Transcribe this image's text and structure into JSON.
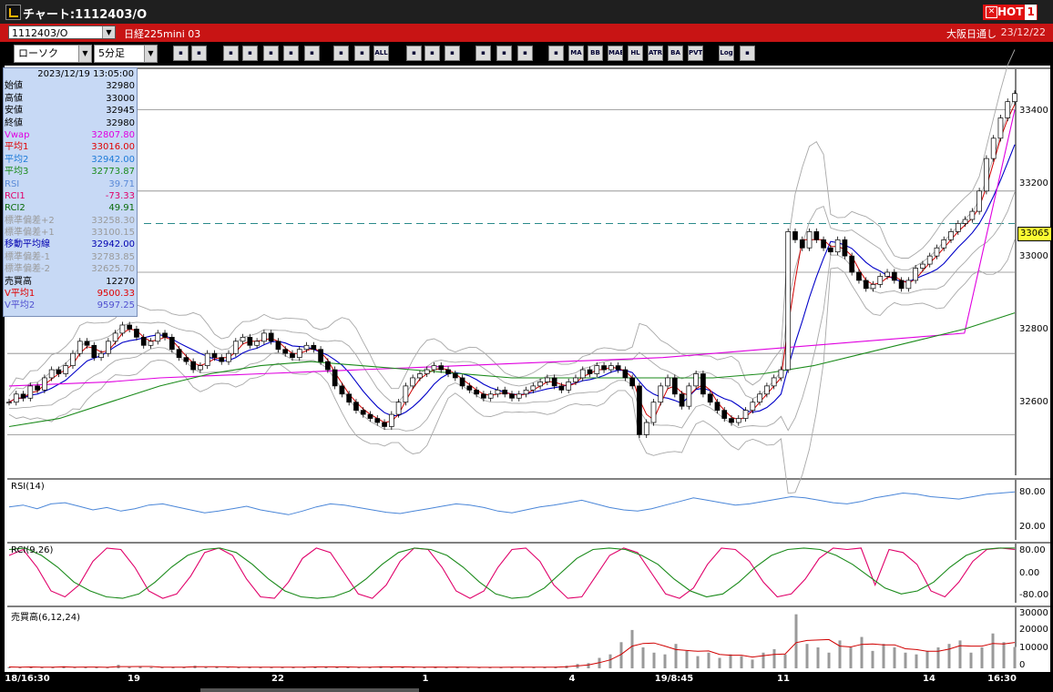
{
  "window": {
    "title": "チャート:1112403/O",
    "hot_label": "HOT",
    "hot_num": "1"
  },
  "infobar": {
    "symbol": "1112403/O",
    "name": "日経225mini 03",
    "market": "大阪日通し",
    "date": "23/12/22"
  },
  "toolbar": {
    "chart_type": "ローソク",
    "interval": "5分足",
    "buttons": [
      "zoom",
      "crosshair",
      "chart1",
      "chart2",
      "chart3",
      "chart4",
      "chart5",
      "candle-up",
      "candle-down",
      "all",
      "draw",
      "select",
      "arrow",
      "gear",
      "settings",
      "palette",
      "ind1",
      "ma",
      "bb",
      "wrae",
      "hl",
      "atr",
      "ba",
      "pvt",
      "log",
      "fit"
    ],
    "button_labels": {
      "all": "ALL",
      "ma": "MA",
      "bb": "BB",
      "wrae": "MAE",
      "hl": "HL",
      "atr": "ATR",
      "ba": "BA",
      "pvt": "PVT",
      "log": "Log"
    }
  },
  "info_panel": {
    "datetime": "2023/12/19  13:05:00",
    "rows": [
      {
        "k": "始値",
        "v": "32980",
        "c": "#000000"
      },
      {
        "k": "高値",
        "v": "33000",
        "c": "#000000"
      },
      {
        "k": "安値",
        "v": "32945",
        "c": "#000000"
      },
      {
        "k": "終値",
        "v": "32980",
        "c": "#000000"
      },
      {
        "k": "Vwap",
        "v": "32807.80",
        "c": "#e000e0"
      },
      {
        "k": "平均1",
        "v": "33016.00",
        "c": "#e00000"
      },
      {
        "k": "平均2",
        "v": "32942.00",
        "c": "#1e7bd8"
      },
      {
        "k": "平均3",
        "v": "32773.87",
        "c": "#1a8a1a"
      },
      {
        "k": "RSI",
        "v": "39.71",
        "c": "#5a8ad8"
      },
      {
        "k": "RCI1",
        "v": "-73.33",
        "c": "#e0006a"
      },
      {
        "k": "RCI2",
        "v": "49.91",
        "c": "#0a6a0a"
      },
      {
        "k": "標準偏差+2",
        "v": "33258.30",
        "c": "#9a9a9a"
      },
      {
        "k": "標準偏差+1",
        "v": "33100.15",
        "c": "#9a9a9a"
      },
      {
        "k": "移動平均線",
        "v": "32942.00",
        "c": "#0000b0"
      },
      {
        "k": "標準偏差-1",
        "v": "32783.85",
        "c": "#9a9a9a"
      },
      {
        "k": "標準偏差-2",
        "v": "32625.70",
        "c": "#9a9a9a"
      },
      {
        "k": "売買高",
        "v": "12270",
        "c": "#000000"
      },
      {
        "k": "V平均1",
        "v": "9500.33",
        "c": "#e00000"
      },
      {
        "k": "V平均2",
        "v": "9597.25",
        "c": "#5050d0"
      }
    ]
  },
  "panes": {
    "price": {
      "y_labels": [
        "33400",
        "33200",
        "33000",
        "32800",
        "32600"
      ],
      "current": "33065"
    },
    "rsi": {
      "label": "RSI(14)",
      "y_labels": [
        "80.00",
        "20.00"
      ]
    },
    "rci": {
      "label": "RCI(9,26)",
      "y_labels": [
        "80.00",
        "0.00",
        "-80.00"
      ]
    },
    "volume": {
      "label": "売買高(6,12,24)",
      "y_labels": [
        "30000",
        "20000",
        "10000",
        "0"
      ]
    }
  },
  "x_labels": [
    "18/16:30",
    "19",
    "22",
    "1",
    "4",
    "19/8:45",
    "11",
    "14",
    "16:30"
  ],
  "chart_data": [
    {
      "type": "candlestick",
      "title": "",
      "ylim": [
        32500,
        33500
      ],
      "y_ticks": [
        33400,
        33200,
        33000,
        32800,
        32600
      ],
      "current_price": 33065,
      "x_tick_labels": [
        "18/16:30",
        "19",
        "22",
        "1",
        "4",
        "19/8:45",
        "11",
        "14",
        "16:30"
      ],
      "close_series": [
        32680,
        32700,
        32690,
        32720,
        32710,
        32740,
        32760,
        32750,
        32770,
        32800,
        32830,
        32820,
        32790,
        32800,
        32830,
        32850,
        32870,
        32860,
        32840,
        32820,
        32830,
        32850,
        32840,
        32810,
        32790,
        32780,
        32760,
        32770,
        32800,
        32790,
        32780,
        32800,
        32830,
        32840,
        32820,
        32830,
        32850,
        32830,
        32810,
        32800,
        32790,
        32810,
        32820,
        32810,
        32780,
        32760,
        32720,
        32700,
        32680,
        32660,
        32650,
        32640,
        32630,
        32620,
        32650,
        32680,
        32720,
        32740,
        32750,
        32760,
        32770,
        32760,
        32750,
        32740,
        32720,
        32710,
        32700,
        32690,
        32700,
        32710,
        32700,
        32690,
        32700,
        32710,
        32720,
        32730,
        32740,
        32720,
        32710,
        32730,
        32740,
        32760,
        32750,
        32770,
        32760,
        32770,
        32760,
        32740,
        32720,
        32600,
        32630,
        32680,
        32720,
        32740,
        32700,
        32670,
        32720,
        32750,
        32700,
        32680,
        32660,
        32640,
        32630,
        32640,
        32660,
        32680,
        32700,
        32720,
        32740,
        32760,
        33100,
        33080,
        33060,
        33100,
        33080,
        33060,
        33050,
        33080,
        33040,
        33000,
        32980,
        32960,
        32970,
        32990,
        33000,
        32980,
        32960,
        32980,
        33010,
        33020,
        33040,
        33060,
        33080,
        33100,
        33120,
        33130,
        33150,
        33200,
        33280,
        33330,
        33380,
        33420,
        33440
      ],
      "series": [
        {
          "name": "Vwap",
          "color": "#e000e0",
          "values": [
            32720,
            32725,
            32730,
            32740,
            32745,
            32750,
            32755,
            32760,
            32765,
            32770,
            32775,
            32780,
            32785,
            32790,
            32800,
            32810,
            32820,
            32830,
            32840,
            32850,
            33400
          ]
        },
        {
          "name": "平均3",
          "color": "#1a8a1a",
          "values": [
            32620,
            32640,
            32680,
            32720,
            32750,
            32770,
            32780,
            32770,
            32760,
            32750,
            32740,
            32740,
            32740,
            32740,
            32740,
            32750,
            32770,
            32800,
            32830,
            32860,
            32900
          ]
        }
      ],
      "bb_values": {
        "+2": 33258.3,
        "+1": 33100.15,
        "ma": 32942.0,
        "-1": 32783.85,
        "-2": 32625.7
      }
    },
    {
      "type": "line",
      "title": "RSI(14)",
      "ylim": [
        0,
        100
      ],
      "y_ticks": [
        80,
        20
      ],
      "values": [
        55,
        58,
        52,
        60,
        62,
        56,
        50,
        54,
        48,
        52,
        58,
        60,
        55,
        50,
        45,
        48,
        52,
        56,
        50,
        46,
        42,
        48,
        55,
        60,
        58,
        54,
        50,
        46,
        44,
        48,
        52,
        56,
        60,
        58,
        54,
        48,
        45,
        50,
        55,
        58,
        62,
        66,
        60,
        54,
        50,
        48,
        52,
        58,
        64,
        70,
        66,
        62,
        58,
        60,
        64,
        68,
        72,
        70,
        66,
        62,
        60,
        64,
        70,
        74,
        78,
        76,
        72,
        70,
        68,
        72,
        76,
        78,
        80
      ]
    },
    {
      "type": "line",
      "title": "RCI(9,26)",
      "ylim": [
        -100,
        100
      ],
      "y_ticks": [
        80,
        0,
        -80
      ],
      "series": [
        {
          "name": "RCI1",
          "color": "#e0006a",
          "values": [
            60,
            80,
            20,
            -60,
            -80,
            -40,
            40,
            85,
            80,
            20,
            -60,
            -85,
            -70,
            -10,
            70,
            85,
            60,
            -20,
            -80,
            -85,
            -30,
            50,
            85,
            70,
            0,
            -70,
            -85,
            -40,
            40,
            85,
            80,
            20,
            -60,
            -85,
            -60,
            20,
            80,
            85,
            40,
            -40,
            -85,
            -80,
            -10,
            60,
            85,
            70,
            0,
            -70,
            -85,
            -50,
            30,
            85,
            80,
            40,
            -30,
            -80,
            -70,
            -20,
            50,
            85,
            80,
            85,
            -40,
            80,
            70,
            30,
            -60,
            -80,
            -30,
            40,
            80,
            85,
            80
          ]
        },
        {
          "name": "RCI2",
          "color": "#1a8a1a",
          "values": [
            80,
            85,
            60,
            20,
            -30,
            -60,
            -80,
            -85,
            -70,
            -30,
            20,
            60,
            80,
            85,
            70,
            30,
            -20,
            -60,
            -80,
            -85,
            -80,
            -60,
            -20,
            30,
            70,
            85,
            80,
            60,
            20,
            -30,
            -70,
            -85,
            -80,
            -50,
            0,
            50,
            80,
            85,
            80,
            60,
            30,
            -20,
            -60,
            -80,
            -70,
            -30,
            20,
            60,
            80,
            85,
            80,
            60,
            30,
            -10,
            -50,
            -70,
            -60,
            -30,
            20,
            60,
            80,
            85,
            85
          ]
        }
      ]
    },
    {
      "type": "bar",
      "title": "売買高(6,12,24)",
      "ylim": [
        0,
        35000
      ],
      "y_ticks": [
        30000,
        20000,
        10000,
        0
      ],
      "values": [
        800,
        600,
        900,
        500,
        700,
        1200,
        400,
        600,
        800,
        500,
        2000,
        700,
        900,
        600,
        500,
        800,
        700,
        1500,
        600,
        800,
        400,
        700,
        900,
        600,
        500,
        700,
        800,
        600,
        1000,
        900,
        700,
        600,
        500,
        800,
        1200,
        600,
        700,
        500,
        800,
        900,
        600,
        700,
        400,
        500,
        600,
        800,
        700,
        500,
        600,
        700,
        900,
        1500,
        2500,
        3000,
        6000,
        8000,
        15000,
        22000,
        12000,
        9000,
        8000,
        14000,
        10000,
        7000,
        9000,
        6000,
        8000,
        7000,
        5000,
        9000,
        11000,
        8000,
        31000,
        14000,
        12000,
        9000,
        16000,
        12000,
        18000,
        10000,
        14000,
        12000,
        9000,
        8000,
        10000,
        12000,
        14000,
        16000,
        9000,
        12000,
        20000,
        15000,
        12270
      ]
    }
  ]
}
